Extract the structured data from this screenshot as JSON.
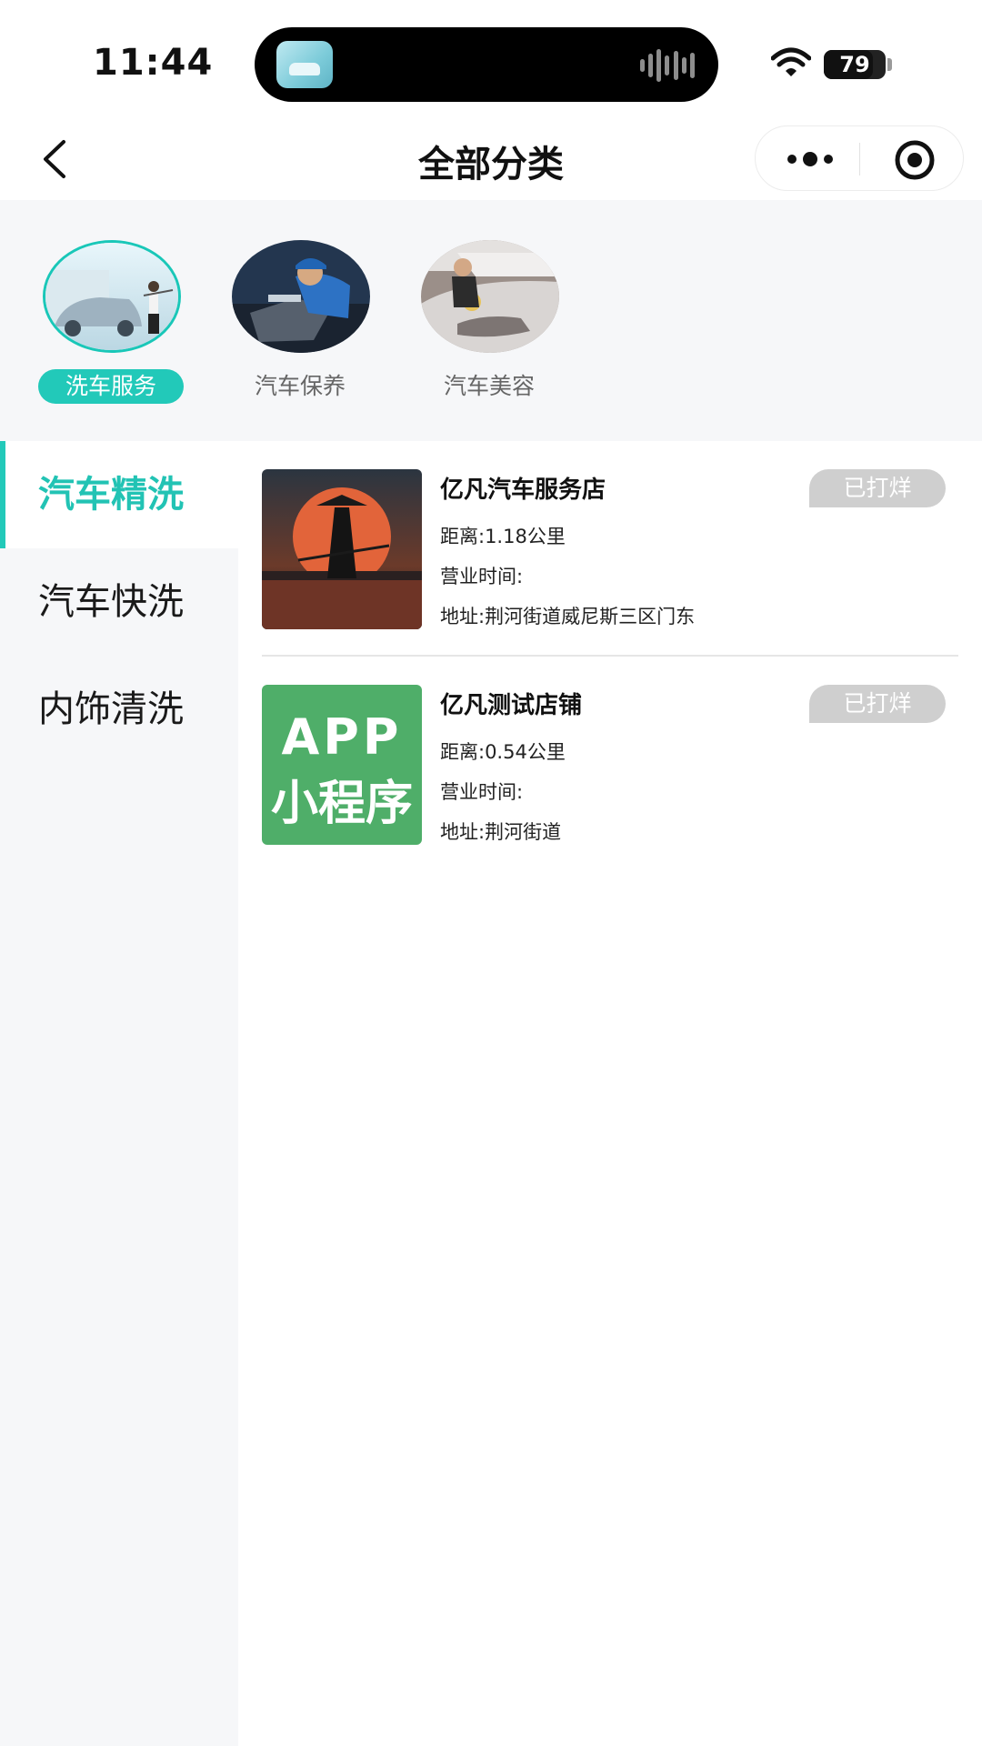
{
  "status_bar": {
    "time": "11:44",
    "battery": "79",
    "battery_level": 0.79
  },
  "nav": {
    "title": "全部分类"
  },
  "categories": [
    {
      "label": "洗车服务",
      "active": true
    },
    {
      "label": "汽车保养",
      "active": false
    },
    {
      "label": "汽车美容",
      "active": false
    }
  ],
  "sidebar": {
    "items": [
      {
        "label": "汽车精洗",
        "active": true
      },
      {
        "label": "汽车快洗",
        "active": false
      },
      {
        "label": "内饰清洗",
        "active": false
      }
    ]
  },
  "stores": [
    {
      "name": "亿凡汽车服务店",
      "status": "已打烊",
      "distance": "距离:1.18公里",
      "hours": "营业时间:",
      "address": "地址:荆河街道威尼斯三区门东"
    },
    {
      "name": "亿凡测试店铺",
      "status": "已打烊",
      "distance": "距离:0.54公里",
      "hours": "营业时间:",
      "address": "地址:荆河街道",
      "thumb_text": [
        "APP",
        "小程序"
      ]
    }
  ],
  "colors": {
    "accent": "#22c9b9",
    "closed_badge": "#cfcfcf",
    "app_tile": "#4fae69"
  }
}
